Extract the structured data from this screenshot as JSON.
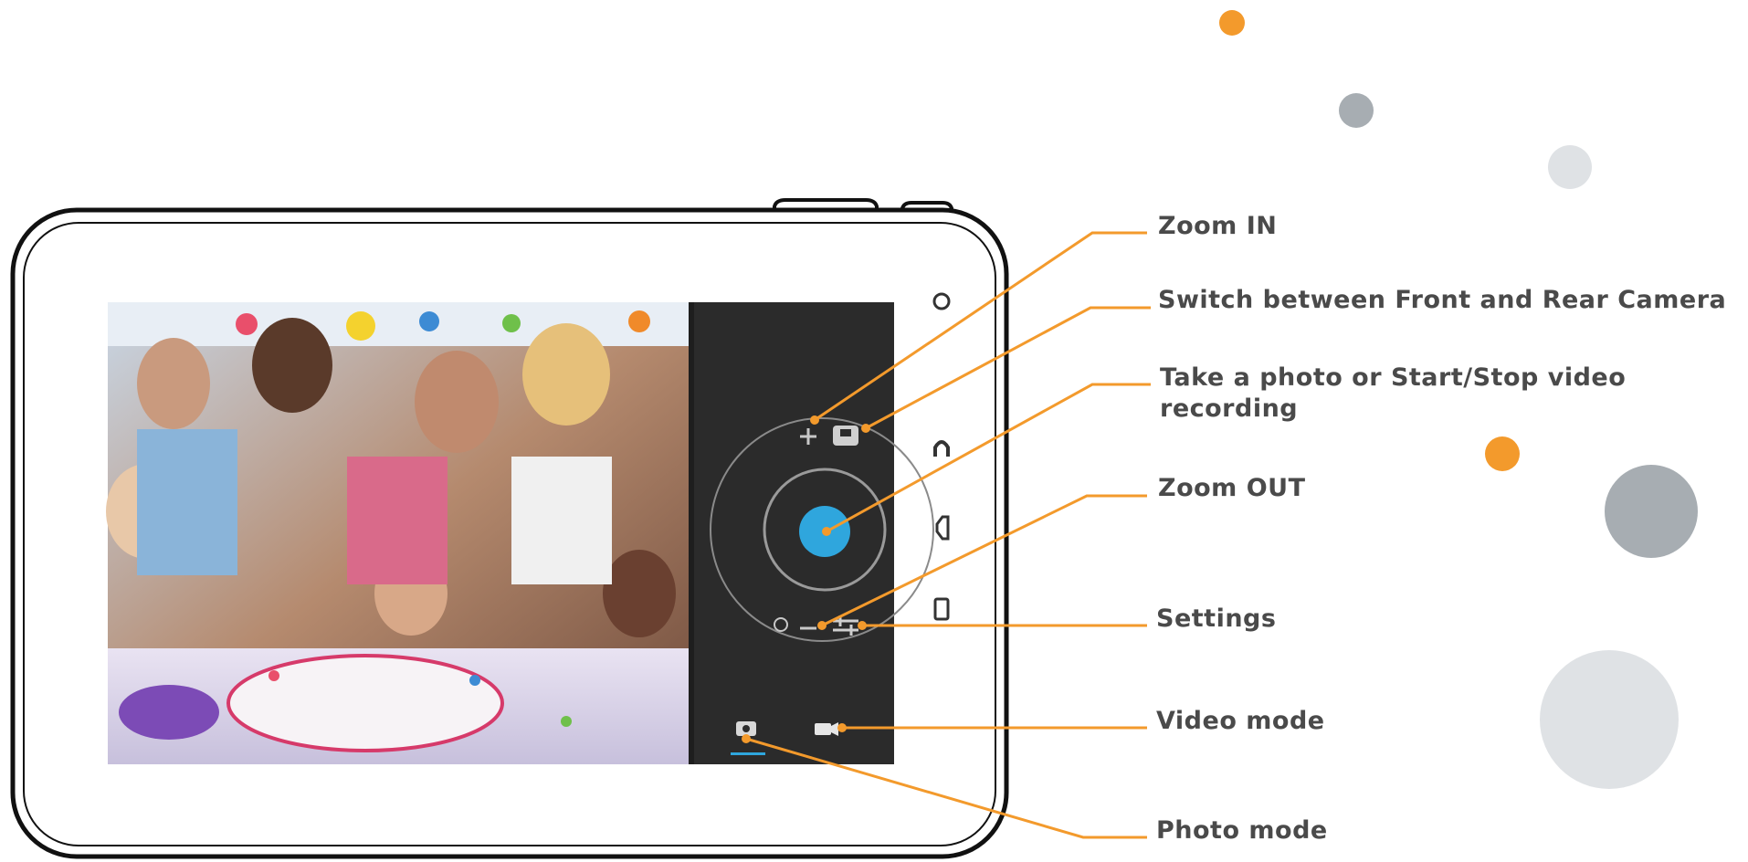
{
  "colors": {
    "accent_orange": "#f39a2c",
    "shutter_blue": "#2fa6dd",
    "dot_gray_dark": "#a7adb2",
    "dot_gray_light": "#dfe2e5",
    "label_text": "#4a4a4a",
    "device_outline": "#111111",
    "panel_dark": "#2b2b2b"
  },
  "callouts": [
    {
      "id": "zoom-in",
      "text": "Zoom IN"
    },
    {
      "id": "switch-camera",
      "text": "Switch between Front and Rear Camera"
    },
    {
      "id": "shutter",
      "text": "Take a photo or Start/Stop video recording"
    },
    {
      "id": "zoom-out",
      "text": "Zoom OUT"
    },
    {
      "id": "settings",
      "text": "Settings"
    },
    {
      "id": "video-mode",
      "text": "Video mode"
    },
    {
      "id": "photo-mode",
      "text": "Photo mode"
    }
  ],
  "device": {
    "side_icons": [
      "circle-icon",
      "headset-icon",
      "speaker-icon",
      "card-slot-icon"
    ],
    "controls": [
      "zoom-in-icon",
      "switch-camera-icon",
      "shutter-button",
      "zoom-out-icon",
      "settings-icon",
      "photo-mode-icon",
      "video-mode-icon"
    ]
  }
}
